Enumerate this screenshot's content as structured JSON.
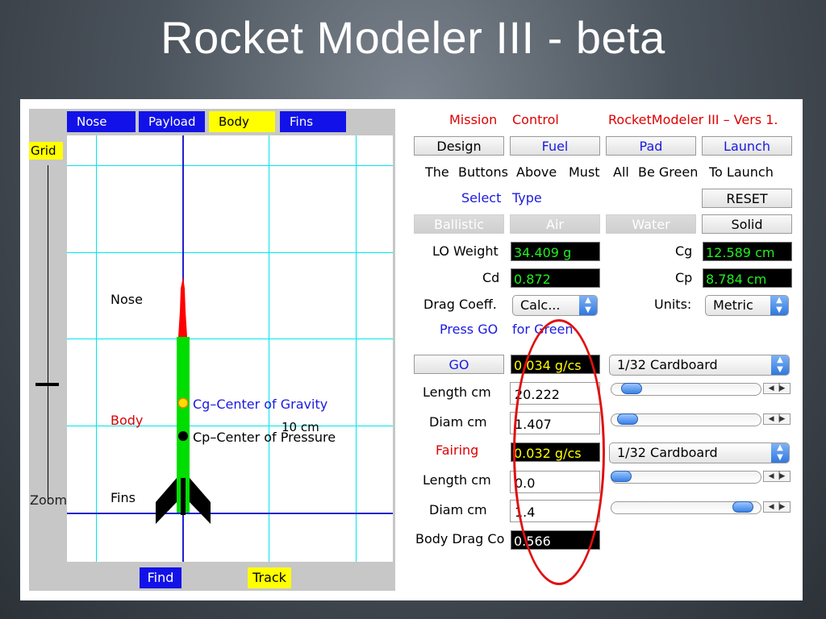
{
  "slide": {
    "title": "Rocket Modeler III - beta"
  },
  "simulator": {
    "tabs": {
      "nose": "Nose",
      "payload": "Payload",
      "body": "Body",
      "fins": "Fins"
    },
    "grid_label": "Grid",
    "zoom_label": "Zoom",
    "parts": {
      "nose": "Nose",
      "body": "Body",
      "fins": "Fins"
    },
    "legend": {
      "cg": "Cg–Center of Gravity",
      "cp": "Cp–Center of Pressure"
    },
    "scale_label": "10 cm",
    "find_label": "Find",
    "track_label": "Track",
    "colors": {
      "nose": "#ff0000",
      "body": "#00dd00",
      "fins": "#000000",
      "cg": "#ffdd00",
      "cp": "#000000"
    }
  },
  "controls": {
    "header": {
      "mission": "Mission",
      "control": "Control",
      "version": "RocketModeler III – Vers 1."
    },
    "nav": {
      "design": "Design",
      "fuel": "Fuel",
      "pad": "Pad",
      "launch": "Launch"
    },
    "instruction": [
      "The",
      "Buttons",
      "Above",
      "Must",
      "All",
      "Be Green",
      "To Launch"
    ],
    "select": "Select",
    "type": "Type",
    "reset": "RESET",
    "types": {
      "ballistic": "Ballistic",
      "air": "Air",
      "water": "Water",
      "solid": "Solid"
    },
    "lo_weight_label": "LO Weight",
    "lo_weight_value": "34.409 g",
    "cg_label": "Cg",
    "cg_value": "12.589 cm",
    "cd_label": "Cd",
    "cd_value": "0.872",
    "cp_label": "Cp",
    "cp_value": "8.784 cm",
    "drag_coeff_label": "Drag Coeff.",
    "drag_coeff_select": "Calc...",
    "units_label": "Units:",
    "units_select": "Metric",
    "press_go": "Press GO",
    "for_green": "for Green",
    "go": "GO",
    "body_density": "0.034 g/cs",
    "body_material": "1/32 Cardboard",
    "body_length_label": "Length cm",
    "body_length": "20.222",
    "body_diam_label": "Diam cm",
    "body_diam": "1.407",
    "fairing_label": "Fairing",
    "fairing_density": "0.032 g/cs",
    "fairing_material": "1/32 Cardboard",
    "fairing_length_label": "Length cm",
    "fairing_length": "0.0",
    "fairing_diam_label": "Diam cm",
    "fairing_diam": "1.4",
    "body_drag_label": "Body Drag Co",
    "body_drag_value": "0.566",
    "sliders": {
      "body_length": 0.08,
      "body_diam": 0.05,
      "fairing_length": 0.0,
      "fairing_diam": 0.95
    }
  }
}
